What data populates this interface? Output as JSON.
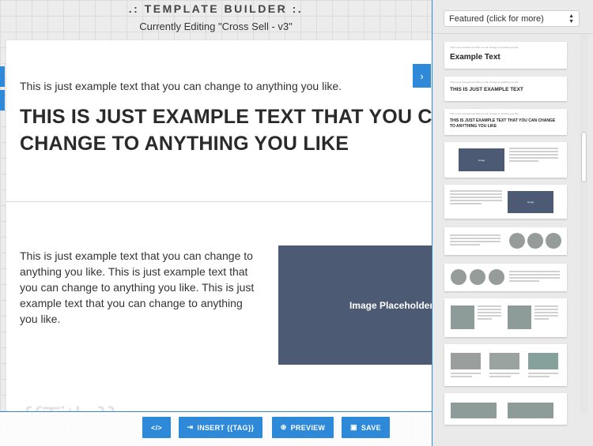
{
  "header": {
    "title": ".: TEMPLATE BUILDER :.",
    "subtitle": "Currently Editing \"Cross Sell - v3\""
  },
  "canvas": {
    "small_text": "This is just example text that you can change to anything you like.",
    "heading": "THIS IS JUST EXAMPLE TEXT THAT YOU CAN CHANGE TO ANYTHING YOU LIKE",
    "paragraph": "This is just example text that you can change to anything you like. This is just example text that you can change to anything you like. This is just example text that you can change to anything you like.",
    "image_label": "Image Placeholder",
    "title_tag": "{{Title}}",
    "next_arrow": "›"
  },
  "toolbar": {
    "code_label": "</>",
    "insert_label": "INSERT {{TAG}}",
    "preview_label": "PREVIEW",
    "save_label": "SAVE",
    "insert_icon": "⇥",
    "preview_icon": "⊕",
    "save_icon": "▣"
  },
  "panel": {
    "select_value": "Featured (click for more)",
    "thumbs": {
      "example_text": "Example Text",
      "example_caps": "THIS IS JUST EXAMPLE TEXT",
      "example_heading": "THIS IS JUST EXAMPLE TEXT THAT YOU CAN CHANGE TO ANYTHING YOU LIKE",
      "small_line": "This is just example text that you can change to anything you like."
    }
  },
  "colors": {
    "accent": "#2e8ad8",
    "image_placeholder": "#4c5a73",
    "gray_green": "#8d9c98"
  }
}
